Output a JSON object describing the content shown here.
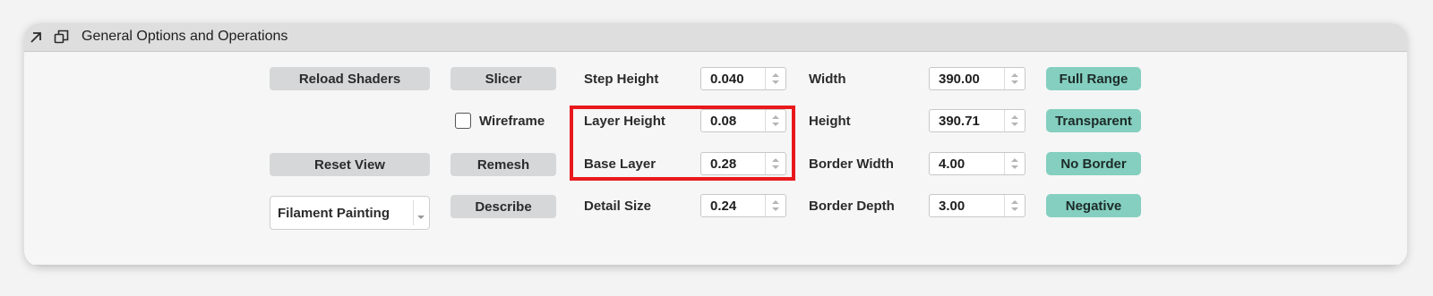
{
  "header": {
    "title": "General Options and Operations",
    "icons": [
      "collapse-arrow-icon",
      "detach-window-icon"
    ]
  },
  "buttons": {
    "reload_shaders": "Reload Shaders",
    "slicer": "Slicer",
    "reset_view": "Reset View",
    "remesh": "Remesh",
    "describe": "Describe"
  },
  "wireframe": {
    "label": "Wireframe",
    "checked": false
  },
  "mode_select": {
    "value": "Filament Painting"
  },
  "layer_params": {
    "step_height": {
      "label": "Step Height",
      "value": "0.040"
    },
    "layer_height": {
      "label": "Layer Height",
      "value": "0.08"
    },
    "base_layer": {
      "label": "Base Layer",
      "value": "0.28"
    },
    "detail_size": {
      "label": "Detail Size",
      "value": "0.24"
    }
  },
  "dimensions": {
    "width": {
      "label": "Width",
      "value": "390.00"
    },
    "height": {
      "label": "Height",
      "value": "390.71"
    },
    "border_width": {
      "label": "Border Width",
      "value": "4.00"
    },
    "border_depth": {
      "label": "Border Depth",
      "value": "3.00"
    }
  },
  "toggles": {
    "full_range": "Full Range",
    "transparent": "Transparent",
    "no_border": "No Border",
    "negative": "Negative"
  },
  "colors": {
    "accent": "#84cfc0",
    "highlight": "#e8191c",
    "button": "#d6d7d9"
  }
}
